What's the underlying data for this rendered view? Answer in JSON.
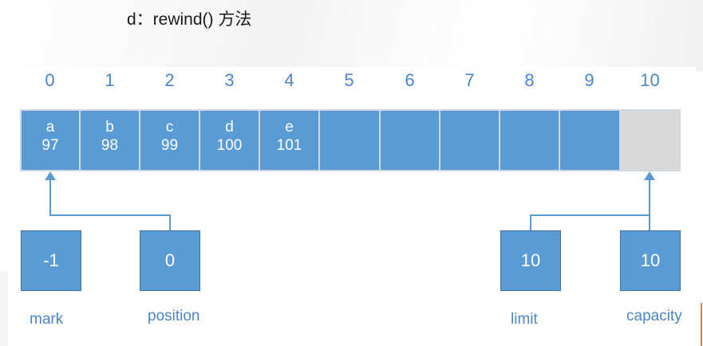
{
  "title": "d：rewind() 方法",
  "indices": [
    "0",
    "1",
    "2",
    "3",
    "4",
    "5",
    "6",
    "7",
    "8",
    "9",
    "10"
  ],
  "cells": [
    {
      "char": "a",
      "value": "97"
    },
    {
      "char": "b",
      "value": "98"
    },
    {
      "char": "c",
      "value": "99"
    },
    {
      "char": "d",
      "value": "100"
    },
    {
      "char": "e",
      "value": "101"
    },
    {
      "char": "",
      "value": ""
    },
    {
      "char": "",
      "value": ""
    },
    {
      "char": "",
      "value": ""
    },
    {
      "char": "",
      "value": ""
    },
    {
      "char": "",
      "value": ""
    },
    {
      "char": "",
      "value": ""
    }
  ],
  "pointers": {
    "mark": {
      "value": "-1",
      "label": "mark"
    },
    "position": {
      "value": "0",
      "label": "position"
    },
    "limit": {
      "value": "10",
      "label": "limit"
    },
    "capacity": {
      "value": "10",
      "label": "capacity"
    }
  },
  "colors": {
    "cell_fill": "#5b9bd5",
    "empty_cell_fill": "#d9d9d9",
    "index_text": "#4a86c8",
    "connector": "#5b9bd5"
  }
}
